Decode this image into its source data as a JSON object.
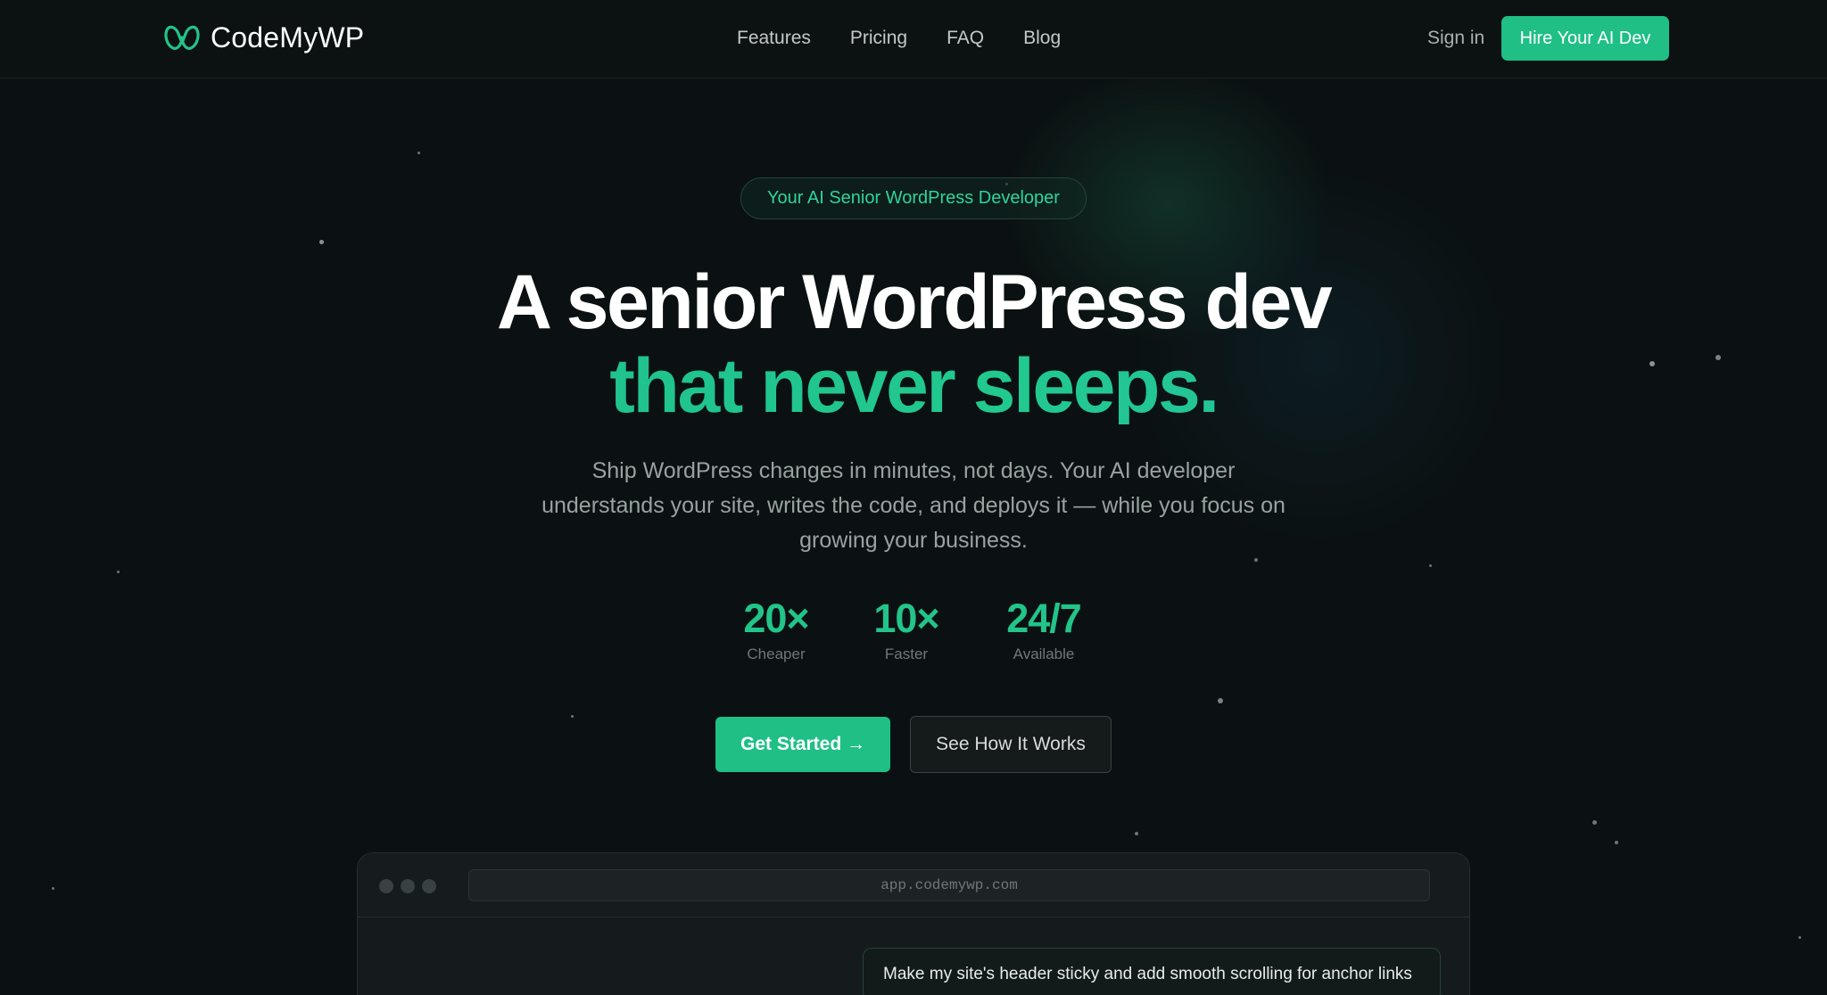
{
  "header": {
    "logo_text": "CodeMyWP",
    "nav": [
      "Features",
      "Pricing",
      "FAQ",
      "Blog"
    ],
    "sign_in": "Sign in",
    "cta": "Hire Your AI Dev"
  },
  "hero": {
    "badge": "Your AI Senior WordPress Developer",
    "headline_line1": "A senior WordPress dev",
    "headline_line2": "that never sleeps.",
    "subtext": "Ship WordPress changes in minutes, not days. Your AI developer understands your site, writes the code, and deploys it — while you focus on growing your business.",
    "stats": [
      {
        "value": "20×",
        "label": "Cheaper"
      },
      {
        "value": "10×",
        "label": "Faster"
      },
      {
        "value": "24/7",
        "label": "Available"
      }
    ],
    "primary_button": "Get Started →",
    "secondary_button": "See How It Works"
  },
  "preview": {
    "url": "app.codemywp.com",
    "message": "Make my site's header sticky and add smooth scrolling for anchor links"
  },
  "colors": {
    "accent": "#1fbf86",
    "background": "#0b1112"
  }
}
